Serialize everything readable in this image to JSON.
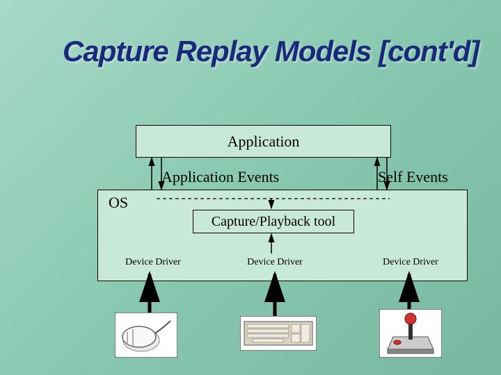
{
  "title": "Capture Replay Models [cont'd]",
  "boxes": {
    "application": "Application",
    "os": "OS",
    "tool": "Capture/Playback tool"
  },
  "labels": {
    "app_events": "Application Events",
    "self_events": "Self Events"
  },
  "drivers": {
    "d1": "Device Driver",
    "d2": "Device Driver",
    "d3": "Device Driver"
  },
  "devices": {
    "mouse": "mouse",
    "keyboard": "keyboard",
    "joystick": "joystick"
  }
}
